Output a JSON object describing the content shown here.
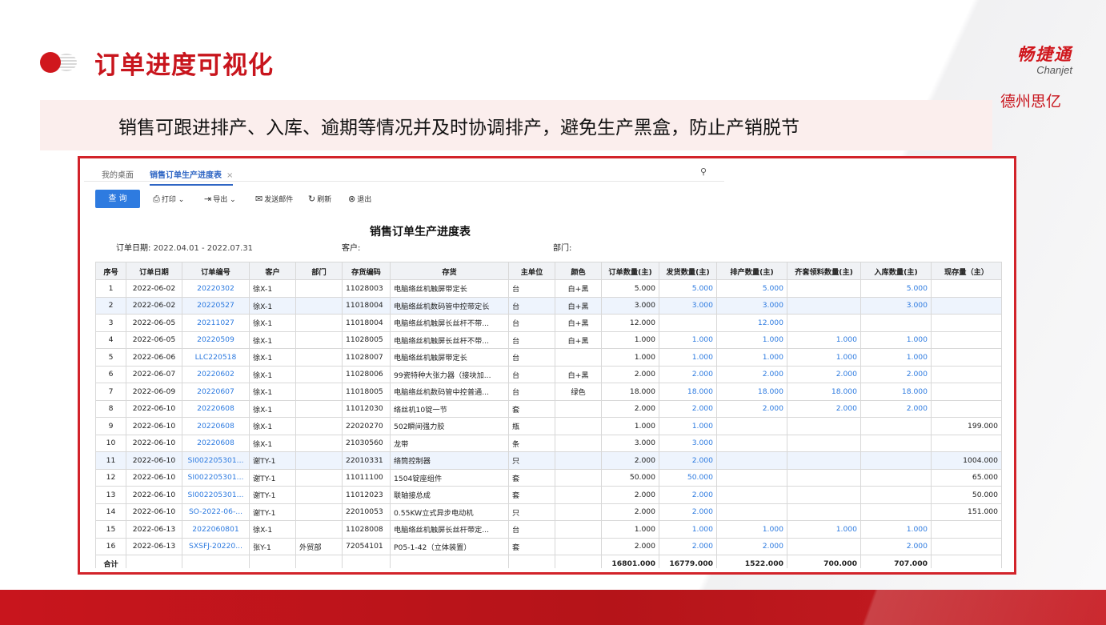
{
  "slide": {
    "title": "订单进度可视化",
    "brand_cn": "畅捷通",
    "brand_en": "Chanjet",
    "org": "德州思亿",
    "subtitle": "销售可跟进排产、入库、逾期等情况并及时协调排产，避免生产黑盒，防止产销脱节"
  },
  "tabs": {
    "home": "我的桌面",
    "active": "销售订单生产进度表",
    "close": "×"
  },
  "toolbar": {
    "query": "查 询",
    "print": "打印",
    "export": "导出",
    "mail": "发送邮件",
    "refresh": "刷新",
    "exit": "退出"
  },
  "report": {
    "title": "销售订单生产进度表",
    "date_label": "订单日期:",
    "date_value": "2022.04.01 - 2022.07.31",
    "customer_label": "客户:",
    "dept_label": "部门:"
  },
  "table": {
    "headers": [
      "序号",
      "订单日期",
      "订单编号",
      "客户",
      "部门",
      "存货编码",
      "存货",
      "主单位",
      "颜色",
      "订单数量(主)",
      "发货数量(主)",
      "排产数量(主)",
      "齐套领料数量(主)",
      "入库数量(主)",
      "现存量（主）"
    ],
    "rows": [
      [
        "1",
        "2022-06-02",
        "20220302",
        "徐X-1",
        "",
        "11028003",
        "电脑络丝机触屏带定长",
        "台",
        "白+黑",
        "5.000",
        "5.000",
        "5.000",
        "",
        "5.000",
        ""
      ],
      [
        "2",
        "2022-06-02",
        "20220527",
        "徐X-1",
        "",
        "11018004",
        "电脑络丝机数码管中控带定长",
        "台",
        "白+黑",
        "3.000",
        "3.000",
        "3.000",
        "",
        "3.000",
        ""
      ],
      [
        "3",
        "2022-06-05",
        "20211027",
        "徐X-1",
        "",
        "11018004",
        "电脑络丝机触屏长丝杆不带...",
        "台",
        "白+黑",
        "12.000",
        "",
        "12.000",
        "",
        "",
        ""
      ],
      [
        "4",
        "2022-06-05",
        "20220509",
        "徐X-1",
        "",
        "11028005",
        "电脑络丝机触屏长丝杆不带...",
        "台",
        "白+黑",
        "1.000",
        "1.000",
        "1.000",
        "1.000",
        "1.000",
        ""
      ],
      [
        "5",
        "2022-06-06",
        "LLC220518",
        "徐X-1",
        "",
        "11028007",
        "电脑络丝机触屏带定长",
        "台",
        "",
        "1.000",
        "1.000",
        "1.000",
        "1.000",
        "1.000",
        ""
      ],
      [
        "6",
        "2022-06-07",
        "20220602",
        "徐X-1",
        "",
        "11028006",
        "99瓷特种大张力器（接块加...",
        "台",
        "白+黑",
        "2.000",
        "2.000",
        "2.000",
        "2.000",
        "2.000",
        ""
      ],
      [
        "7",
        "2022-06-09",
        "20220607",
        "徐X-1",
        "",
        "11018005",
        "电脑络丝机数码管中控普通...",
        "台",
        "绿色",
        "18.000",
        "18.000",
        "18.000",
        "18.000",
        "18.000",
        ""
      ],
      [
        "8",
        "2022-06-10",
        "20220608",
        "徐X-1",
        "",
        "11012030",
        "络丝机10锭一节",
        "套",
        "",
        "2.000",
        "2.000",
        "2.000",
        "2.000",
        "2.000",
        ""
      ],
      [
        "9",
        "2022-06-10",
        "20220608",
        "徐X-1",
        "",
        "22020270",
        "502瞬间强力胶",
        "瓶",
        "",
        "1.000",
        "1.000",
        "",
        "",
        "",
        "199.000"
      ],
      [
        "10",
        "2022-06-10",
        "20220608",
        "徐X-1",
        "",
        "21030560",
        "龙带",
        "条",
        "",
        "3.000",
        "3.000",
        "",
        "",
        "",
        ""
      ],
      [
        "11",
        "2022-06-10",
        "SI002205301...",
        "谢TY-1",
        "",
        "22010331",
        "络筒控制器",
        "只",
        "",
        "2.000",
        "2.000",
        "",
        "",
        "",
        "1004.000"
      ],
      [
        "12",
        "2022-06-10",
        "SI002205301...",
        "谢TY-1",
        "",
        "11011100",
        "1504锭座组件",
        "套",
        "",
        "50.000",
        "50.000",
        "",
        "",
        "",
        "65.000"
      ],
      [
        "13",
        "2022-06-10",
        "SI002205301...",
        "谢TY-1",
        "",
        "11012023",
        "联轴接总成",
        "套",
        "",
        "2.000",
        "2.000",
        "",
        "",
        "",
        "50.000"
      ],
      [
        "14",
        "2022-06-10",
        "SO-2022-06-...",
        "谢TY-1",
        "",
        "22010053",
        "0.55KW立式异步电动机",
        "只",
        "",
        "2.000",
        "2.000",
        "",
        "",
        "",
        "151.000"
      ],
      [
        "15",
        "2022-06-13",
        "2022060801",
        "徐X-1",
        "",
        "11028008",
        "电脑络丝机触屏长丝杆带定...",
        "台",
        "",
        "1.000",
        "1.000",
        "1.000",
        "1.000",
        "1.000",
        ""
      ],
      [
        "16",
        "2022-06-13",
        "SXSFJ-20220...",
        "张Y-1",
        "外贸部",
        "72054101",
        "P05-1-42（立体装置）",
        "套",
        "",
        "2.000",
        "2.000",
        "2.000",
        "",
        "2.000",
        ""
      ]
    ],
    "total": [
      "合计",
      "",
      "",
      "",
      "",
      "",
      "",
      "",
      "",
      "16801.000",
      "16779.000",
      "1522.000",
      "700.000",
      "707.000",
      ""
    ]
  }
}
